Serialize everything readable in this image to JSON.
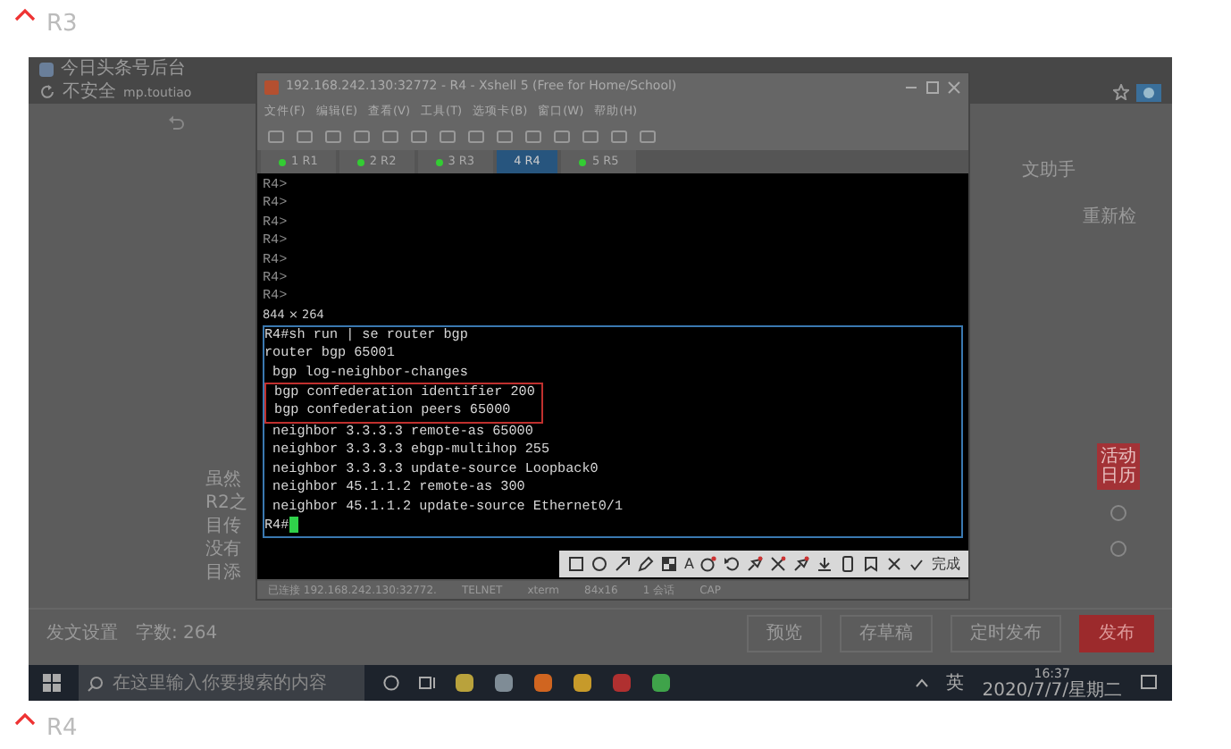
{
  "section_heading": {
    "label": "R3"
  },
  "screenshot": {
    "browser": {
      "tab_title": "今日头条号后台",
      "security": "不安全",
      "url": "mp.toutiao"
    },
    "terminal_window": {
      "title": "192.168.242.130:32772 - R4 - Xshell 5 (Free for Home/School)",
      "menu": [
        "文件(F)",
        "编辑(E)",
        "查看(V)",
        "工具(T)",
        "选项卡(B)",
        "窗口(W)",
        "帮助(H)"
      ],
      "tabs": [
        {
          "label": "1 R1",
          "selected": false
        },
        {
          "label": "2 R2",
          "selected": false
        },
        {
          "label": "3 R3",
          "selected": false
        },
        {
          "label": "4 R4",
          "selected": true
        },
        {
          "label": "5 R5",
          "selected": false
        }
      ],
      "prompt_lines": [
        "R4>",
        "R4>",
        "R4>",
        "R4>",
        "R4>",
        "R4>",
        "R4>"
      ],
      "selection_size": "844 × 264",
      "selected_lines": [
        {
          "text": "R4#sh run | se router bgp",
          "highlighted": false
        },
        {
          "text": "router bgp 65001",
          "highlighted": false
        },
        {
          "text": " bgp log-neighbor-changes",
          "highlighted": false
        },
        {
          "text": " bgp confederation identifier 200",
          "highlighted": true
        },
        {
          "text": " bgp confederation peers 65000",
          "highlighted": true
        },
        {
          "text": " neighbor 3.3.3.3 remote-as 65000",
          "highlighted": false
        },
        {
          "text": " neighbor 3.3.3.3 ebgp-multihop 255",
          "highlighted": false
        },
        {
          "text": " neighbor 3.3.3.3 update-source Loopback0",
          "highlighted": false
        },
        {
          "text": " neighbor 45.1.1.2 remote-as 300",
          "highlighted": false
        },
        {
          "text": " neighbor 45.1.1.2 update-source Ethernet0/1",
          "highlighted": false
        },
        {
          "text": "R4#",
          "highlighted": false
        }
      ],
      "status_bar": [
        "已连接 192.168.242.130:32772.",
        "TELNET",
        "xterm",
        "84x16",
        "1 会话",
        "CAP"
      ]
    },
    "annotation_toolbar": {
      "tools": [
        {
          "kind": "rect"
        },
        {
          "kind": "circle"
        },
        {
          "kind": "arrow"
        },
        {
          "kind": "pen"
        },
        {
          "kind": "mosaic"
        },
        {
          "kind": "text",
          "label": "A"
        },
        {
          "kind": "number"
        },
        {
          "kind": "undo"
        },
        {
          "kind": "pin"
        },
        {
          "kind": "cross"
        },
        {
          "kind": "pin"
        },
        {
          "kind": "download"
        },
        {
          "kind": "phone"
        },
        {
          "kind": "bookmark"
        },
        {
          "kind": "close"
        }
      ],
      "done": "完成"
    },
    "article_lines": [
      "虽然",
      "R2之",
      "目传",
      "没有",
      "目添"
    ],
    "side_links": [
      "文助手",
      "重新检"
    ],
    "float_button": "活动日历",
    "publish_bar": {
      "settings_label": "发文设置",
      "word_count": "字数: 264",
      "buttons": [
        {
          "label": "预览",
          "kind": "plain"
        },
        {
          "label": "存草稿",
          "kind": "plain"
        },
        {
          "label": "定时发布",
          "kind": "plain"
        },
        {
          "label": "发布",
          "kind": "primary"
        }
      ]
    },
    "taskbar": {
      "search_placeholder": "在这里输入你要搜索的内容",
      "ime": "英",
      "time": "16:37",
      "date": "2020/7/7/星期二"
    }
  },
  "next_heading": {
    "label": "R4"
  }
}
